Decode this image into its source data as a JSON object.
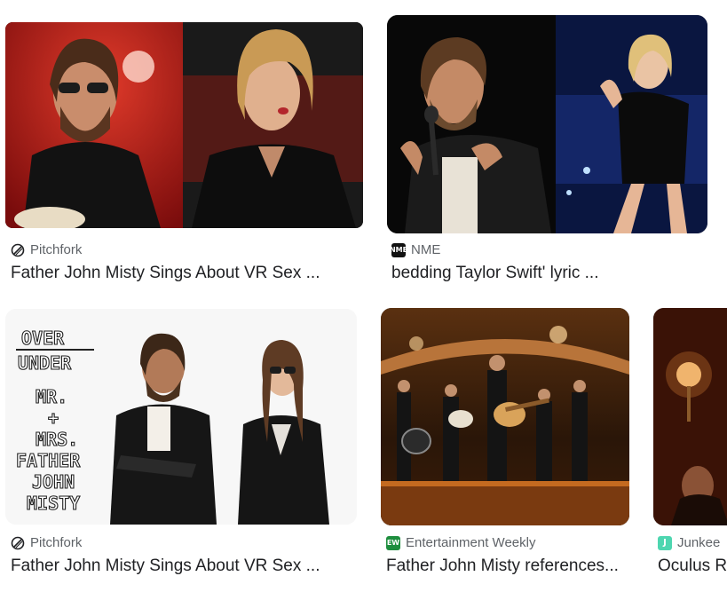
{
  "results": [
    {
      "source": "Pitchfork",
      "title": "Father John Misty Sings About VR Sex ...",
      "favicon": "pitchfork-icon"
    },
    {
      "source": "NME",
      "title": "bedding Taylor Swift' lyric ...",
      "favicon": "nme-icon",
      "favicon_text": "NME"
    },
    {
      "source": "Pitchfork",
      "title": "Father John Misty Sings About VR Sex ...",
      "favicon": "pitchfork-icon",
      "thumb_text": [
        "OVER",
        "UNDER",
        "MR.",
        "+",
        "MRS.",
        "FATHER",
        "JOHN",
        "MISTY"
      ]
    },
    {
      "source": "Entertainment Weekly",
      "title": "Father John Misty references...",
      "favicon": "ew-icon",
      "favicon_text": "EW"
    },
    {
      "source": "Junkee",
      "title": "Oculus R",
      "favicon": "junkee-icon",
      "favicon_text": "J"
    }
  ],
  "colors": {
    "title": "#202124",
    "source": "#5f6368",
    "ew_brand": "#1e8e3e",
    "junkee_brand": "#4ed6b0"
  }
}
